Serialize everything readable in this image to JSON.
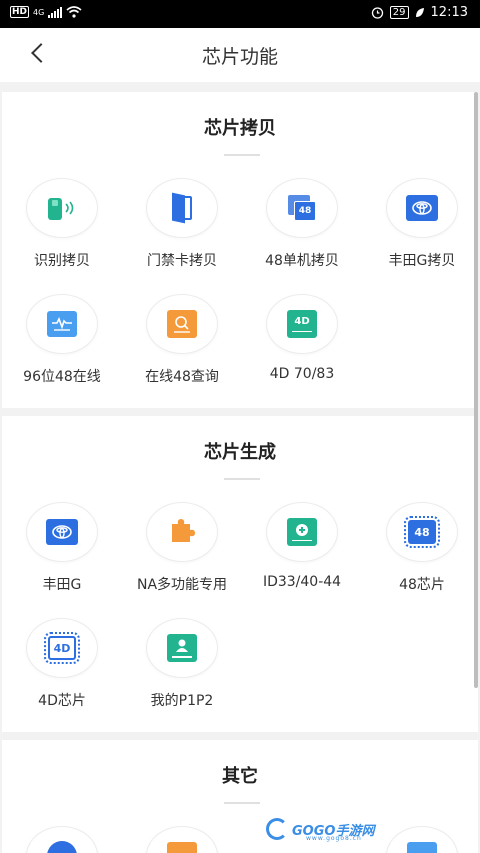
{
  "status_bar": {
    "network": "4G",
    "badge": "HD",
    "battery": "29",
    "time": "12:13"
  },
  "header": {
    "title": "芯片功能"
  },
  "sections": [
    {
      "title": "芯片拷贝",
      "items": [
        {
          "label": "识别拷贝",
          "icon": "phone-nfc-icon"
        },
        {
          "label": "门禁卡拷贝",
          "icon": "door-icon"
        },
        {
          "label": "48单机拷贝",
          "icon": "chip-48-stack-icon"
        },
        {
          "label": "丰田G拷贝",
          "icon": "toyota-icon"
        },
        {
          "label": "96位48在线",
          "icon": "waveform-icon"
        },
        {
          "label": "在线48查询",
          "icon": "search-card-icon"
        },
        {
          "label": "4D 70/83",
          "icon": "chip-4d-icon"
        }
      ]
    },
    {
      "title": "芯片生成",
      "items": [
        {
          "label": "丰田G",
          "icon": "toyota-icon"
        },
        {
          "label": "NA多功能专用",
          "icon": "puzzle-icon"
        },
        {
          "label": "ID33/40-44",
          "icon": "plus-card-icon"
        },
        {
          "label": "48芯片",
          "icon": "chip-48-icon"
        },
        {
          "label": "4D芯片",
          "icon": "chip-4d-outline-icon"
        },
        {
          "label": "我的P1P2",
          "icon": "person-card-icon"
        }
      ]
    },
    {
      "title": "其它",
      "items": []
    }
  ],
  "watermark": {
    "text": "GOGO手游网",
    "sub": "www.gogo8.cn"
  },
  "colors": {
    "teal": "#22b38f",
    "blue": "#2d6fe0",
    "lightblue": "#4a9ef0",
    "orange": "#f59a3a"
  }
}
